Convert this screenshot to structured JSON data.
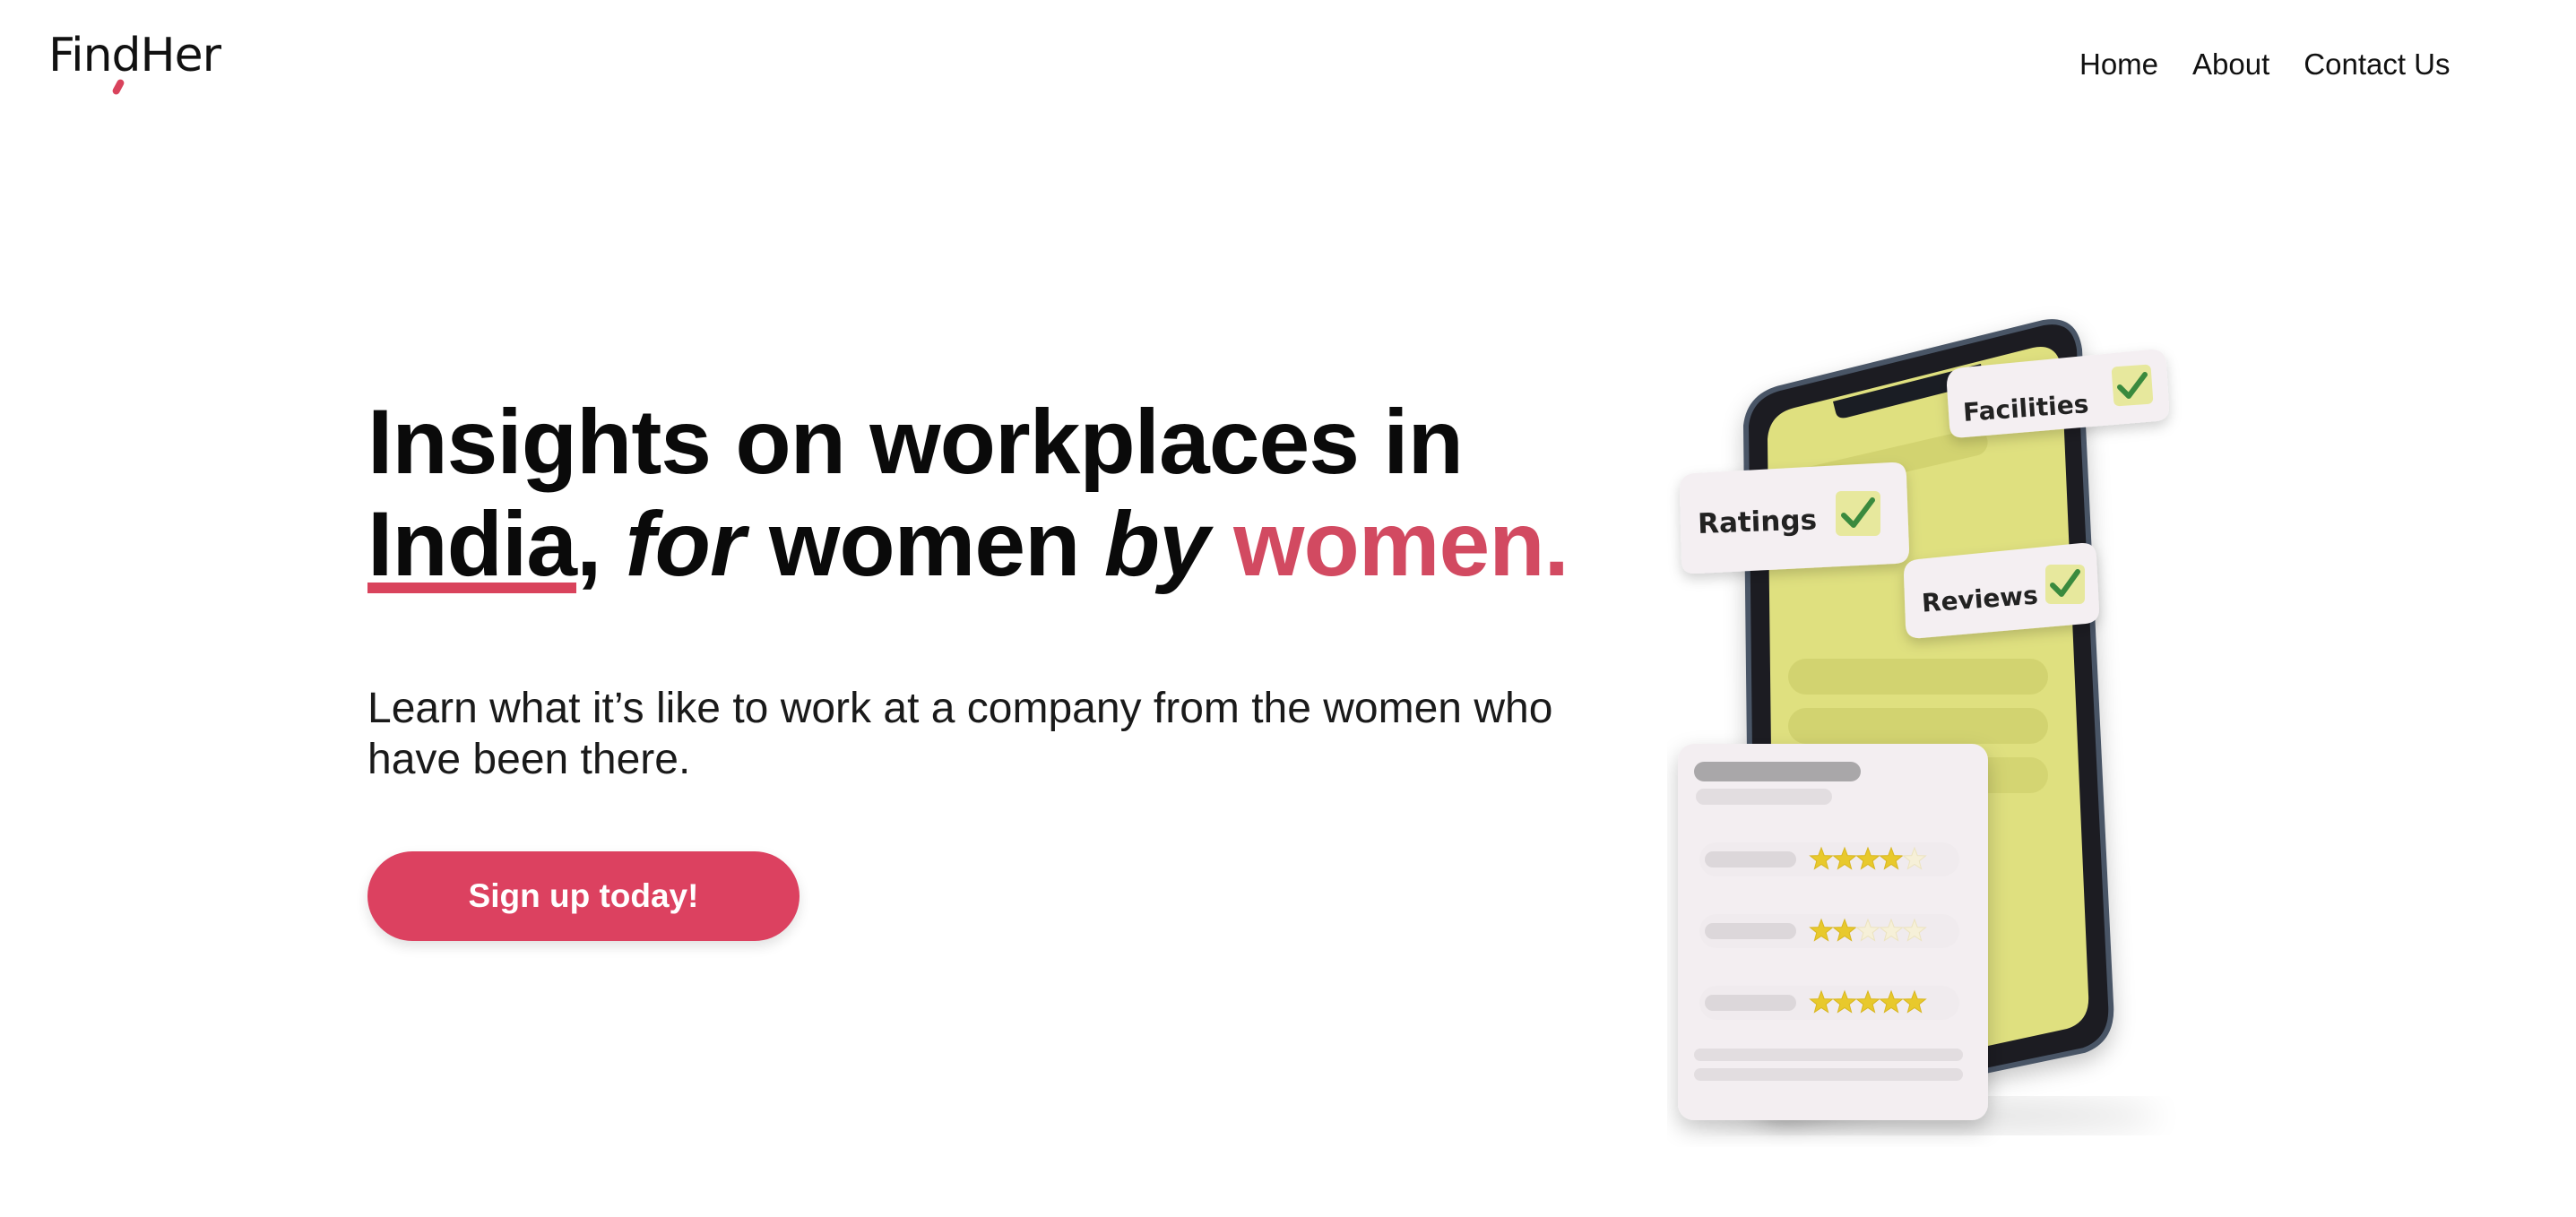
{
  "brand": {
    "logo_text": "FindHer",
    "accent_color": "#dc4160"
  },
  "nav": {
    "items": [
      "Home",
      "About",
      "Contact Us"
    ]
  },
  "hero": {
    "headline": {
      "part1": "Insights on workplaces in",
      "underlined": "India",
      "comma": ",",
      "italic1": "for",
      "mid": "women",
      "italic2": "by",
      "accent": "women."
    },
    "subtext": "Learn what it’s like to work at a company from the women who have been there.",
    "cta_label": "Sign up today!"
  },
  "illustration": {
    "cards": {
      "facilities": "Facilities",
      "ratings": "Ratings",
      "reviews": "Reviews"
    },
    "star_ratings": [
      4,
      2,
      5
    ],
    "screen_color": "#dfe07f",
    "star_color": "#e8c92c",
    "check_color": "#3a8a3e"
  }
}
